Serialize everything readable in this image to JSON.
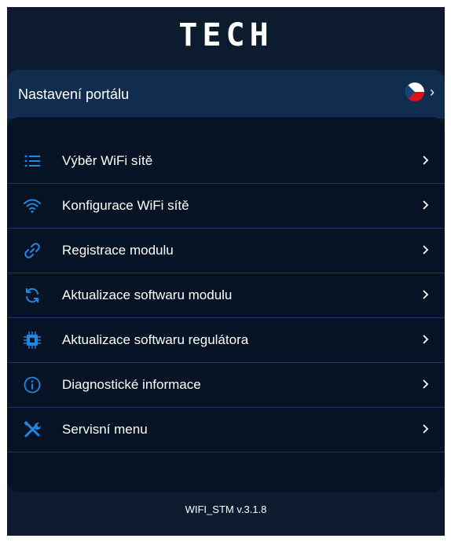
{
  "logo": "TECH",
  "header": {
    "title": "Nastavení portálu",
    "language_icon": "czech-flag-icon"
  },
  "menu": {
    "items": [
      {
        "label": "Výběr WiFi sítě",
        "icon": "list-icon"
      },
      {
        "label": "Konfigurace WiFi sítě",
        "icon": "wifi-icon"
      },
      {
        "label": "Registrace modulu",
        "icon": "link-icon"
      },
      {
        "label": "Aktualizace softwaru modulu",
        "icon": "refresh-icon"
      },
      {
        "label": "Aktualizace softwaru regulátora",
        "icon": "chip-icon"
      },
      {
        "label": "Diagnostické informace",
        "icon": "info-icon"
      },
      {
        "label": "Servisní menu",
        "icon": "tools-icon"
      }
    ]
  },
  "footer": {
    "version": "WIFI_STM v.3.1.8"
  },
  "colors": {
    "background": "#0d1b2e",
    "header": "#102c4e",
    "panel": "#061324",
    "accent": "#1e88e5",
    "divider": "#1a3a61"
  }
}
